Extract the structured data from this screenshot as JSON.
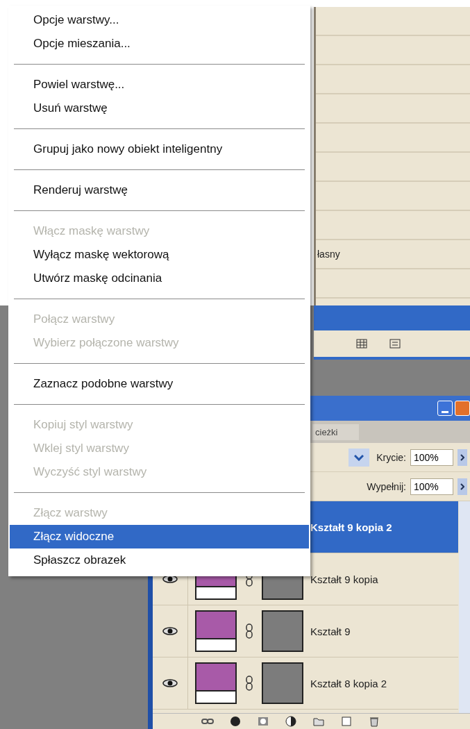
{
  "background_list": {
    "visible_text": "łasny"
  },
  "layers_panel": {
    "tab_label": "cieżki",
    "opacity": {
      "label": "Krycie:",
      "value": "100%"
    },
    "fill": {
      "label": "Wypełnij:",
      "value": "100%"
    },
    "layers": [
      {
        "name": "Kształt 9 kopia 2",
        "selected": true
      },
      {
        "name": "Kształt 9 kopia",
        "selected": false
      },
      {
        "name": "Kształt 9",
        "selected": false
      },
      {
        "name": "Kształt 8 kopia 2",
        "selected": false
      }
    ]
  },
  "context_menu": {
    "items": [
      {
        "kind": "item",
        "label": "Opcje warstwy...",
        "disabled": false,
        "selected": false
      },
      {
        "kind": "item",
        "label": "Opcje mieszania...",
        "disabled": false,
        "selected": false
      },
      {
        "kind": "separator"
      },
      {
        "kind": "item",
        "label": "Powiel warstwę...",
        "disabled": false,
        "selected": false
      },
      {
        "kind": "item",
        "label": "Usuń warstwę",
        "disabled": false,
        "selected": false
      },
      {
        "kind": "separator"
      },
      {
        "kind": "item",
        "label": "Grupuj jako nowy obiekt inteligentny",
        "disabled": false,
        "selected": false
      },
      {
        "kind": "separator"
      },
      {
        "kind": "item",
        "label": "Renderuj warstwę",
        "disabled": false,
        "selected": false
      },
      {
        "kind": "separator"
      },
      {
        "kind": "item",
        "label": "Włącz maskę warstwy",
        "disabled": true,
        "selected": false
      },
      {
        "kind": "item",
        "label": "Wyłącz maskę wektorową",
        "disabled": false,
        "selected": false
      },
      {
        "kind": "item",
        "label": "Utwórz maskę odcinania",
        "disabled": false,
        "selected": false
      },
      {
        "kind": "separator"
      },
      {
        "kind": "item",
        "label": "Połącz warstwy",
        "disabled": true,
        "selected": false
      },
      {
        "kind": "item",
        "label": "Wybierz połączone warstwy",
        "disabled": true,
        "selected": false
      },
      {
        "kind": "separator"
      },
      {
        "kind": "item",
        "label": "Zaznacz podobne warstwy",
        "disabled": false,
        "selected": false
      },
      {
        "kind": "separator"
      },
      {
        "kind": "item",
        "label": "Kopiuj styl warstwy",
        "disabled": true,
        "selected": false
      },
      {
        "kind": "item",
        "label": "Wklej styl warstwy",
        "disabled": true,
        "selected": false
      },
      {
        "kind": "item",
        "label": "Wyczyść styl warstwy",
        "disabled": true,
        "selected": false
      },
      {
        "kind": "separator"
      },
      {
        "kind": "item",
        "label": "Złącz warstwy",
        "disabled": true,
        "selected": false
      },
      {
        "kind": "item",
        "label": "Złącz widoczne",
        "disabled": false,
        "selected": true
      },
      {
        "kind": "item",
        "label": "Spłaszcz obrazek",
        "disabled": false,
        "selected": false
      }
    ]
  }
}
